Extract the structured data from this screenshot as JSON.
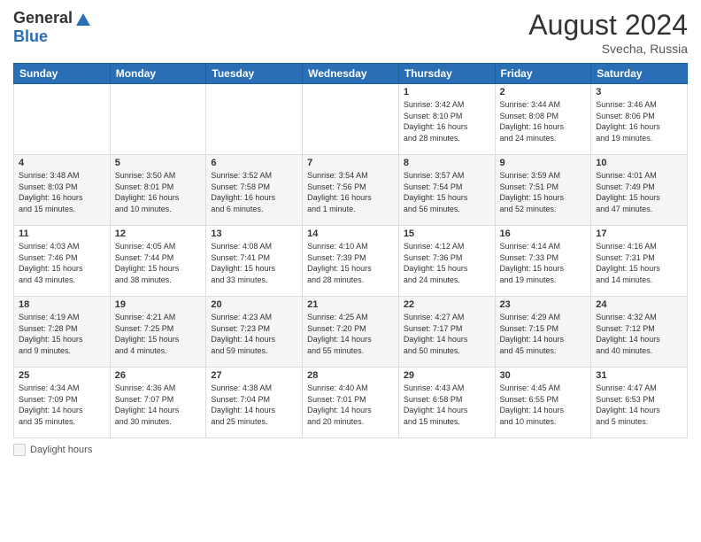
{
  "header": {
    "logo_general": "General",
    "logo_blue": "Blue",
    "month_title": "August 2024",
    "subtitle": "Svecha, Russia"
  },
  "footer": {
    "legend_label": "Daylight hours"
  },
  "days_of_week": [
    "Sunday",
    "Monday",
    "Tuesday",
    "Wednesday",
    "Thursday",
    "Friday",
    "Saturday"
  ],
  "weeks": [
    [
      {
        "day": "",
        "info": ""
      },
      {
        "day": "",
        "info": ""
      },
      {
        "day": "",
        "info": ""
      },
      {
        "day": "",
        "info": ""
      },
      {
        "day": "1",
        "info": "Sunrise: 3:42 AM\nSunset: 8:10 PM\nDaylight: 16 hours\nand 28 minutes."
      },
      {
        "day": "2",
        "info": "Sunrise: 3:44 AM\nSunset: 8:08 PM\nDaylight: 16 hours\nand 24 minutes."
      },
      {
        "day": "3",
        "info": "Sunrise: 3:46 AM\nSunset: 8:06 PM\nDaylight: 16 hours\nand 19 minutes."
      }
    ],
    [
      {
        "day": "4",
        "info": "Sunrise: 3:48 AM\nSunset: 8:03 PM\nDaylight: 16 hours\nand 15 minutes."
      },
      {
        "day": "5",
        "info": "Sunrise: 3:50 AM\nSunset: 8:01 PM\nDaylight: 16 hours\nand 10 minutes."
      },
      {
        "day": "6",
        "info": "Sunrise: 3:52 AM\nSunset: 7:58 PM\nDaylight: 16 hours\nand 6 minutes."
      },
      {
        "day": "7",
        "info": "Sunrise: 3:54 AM\nSunset: 7:56 PM\nDaylight: 16 hours\nand 1 minute."
      },
      {
        "day": "8",
        "info": "Sunrise: 3:57 AM\nSunset: 7:54 PM\nDaylight: 15 hours\nand 56 minutes."
      },
      {
        "day": "9",
        "info": "Sunrise: 3:59 AM\nSunset: 7:51 PM\nDaylight: 15 hours\nand 52 minutes."
      },
      {
        "day": "10",
        "info": "Sunrise: 4:01 AM\nSunset: 7:49 PM\nDaylight: 15 hours\nand 47 minutes."
      }
    ],
    [
      {
        "day": "11",
        "info": "Sunrise: 4:03 AM\nSunset: 7:46 PM\nDaylight: 15 hours\nand 43 minutes."
      },
      {
        "day": "12",
        "info": "Sunrise: 4:05 AM\nSunset: 7:44 PM\nDaylight: 15 hours\nand 38 minutes."
      },
      {
        "day": "13",
        "info": "Sunrise: 4:08 AM\nSunset: 7:41 PM\nDaylight: 15 hours\nand 33 minutes."
      },
      {
        "day": "14",
        "info": "Sunrise: 4:10 AM\nSunset: 7:39 PM\nDaylight: 15 hours\nand 28 minutes."
      },
      {
        "day": "15",
        "info": "Sunrise: 4:12 AM\nSunset: 7:36 PM\nDaylight: 15 hours\nand 24 minutes."
      },
      {
        "day": "16",
        "info": "Sunrise: 4:14 AM\nSunset: 7:33 PM\nDaylight: 15 hours\nand 19 minutes."
      },
      {
        "day": "17",
        "info": "Sunrise: 4:16 AM\nSunset: 7:31 PM\nDaylight: 15 hours\nand 14 minutes."
      }
    ],
    [
      {
        "day": "18",
        "info": "Sunrise: 4:19 AM\nSunset: 7:28 PM\nDaylight: 15 hours\nand 9 minutes."
      },
      {
        "day": "19",
        "info": "Sunrise: 4:21 AM\nSunset: 7:25 PM\nDaylight: 15 hours\nand 4 minutes."
      },
      {
        "day": "20",
        "info": "Sunrise: 4:23 AM\nSunset: 7:23 PM\nDaylight: 14 hours\nand 59 minutes."
      },
      {
        "day": "21",
        "info": "Sunrise: 4:25 AM\nSunset: 7:20 PM\nDaylight: 14 hours\nand 55 minutes."
      },
      {
        "day": "22",
        "info": "Sunrise: 4:27 AM\nSunset: 7:17 PM\nDaylight: 14 hours\nand 50 minutes."
      },
      {
        "day": "23",
        "info": "Sunrise: 4:29 AM\nSunset: 7:15 PM\nDaylight: 14 hours\nand 45 minutes."
      },
      {
        "day": "24",
        "info": "Sunrise: 4:32 AM\nSunset: 7:12 PM\nDaylight: 14 hours\nand 40 minutes."
      }
    ],
    [
      {
        "day": "25",
        "info": "Sunrise: 4:34 AM\nSunset: 7:09 PM\nDaylight: 14 hours\nand 35 minutes."
      },
      {
        "day": "26",
        "info": "Sunrise: 4:36 AM\nSunset: 7:07 PM\nDaylight: 14 hours\nand 30 minutes."
      },
      {
        "day": "27",
        "info": "Sunrise: 4:38 AM\nSunset: 7:04 PM\nDaylight: 14 hours\nand 25 minutes."
      },
      {
        "day": "28",
        "info": "Sunrise: 4:40 AM\nSunset: 7:01 PM\nDaylight: 14 hours\nand 20 minutes."
      },
      {
        "day": "29",
        "info": "Sunrise: 4:43 AM\nSunset: 6:58 PM\nDaylight: 14 hours\nand 15 minutes."
      },
      {
        "day": "30",
        "info": "Sunrise: 4:45 AM\nSunset: 6:55 PM\nDaylight: 14 hours\nand 10 minutes."
      },
      {
        "day": "31",
        "info": "Sunrise: 4:47 AM\nSunset: 6:53 PM\nDaylight: 14 hours\nand 5 minutes."
      }
    ]
  ]
}
